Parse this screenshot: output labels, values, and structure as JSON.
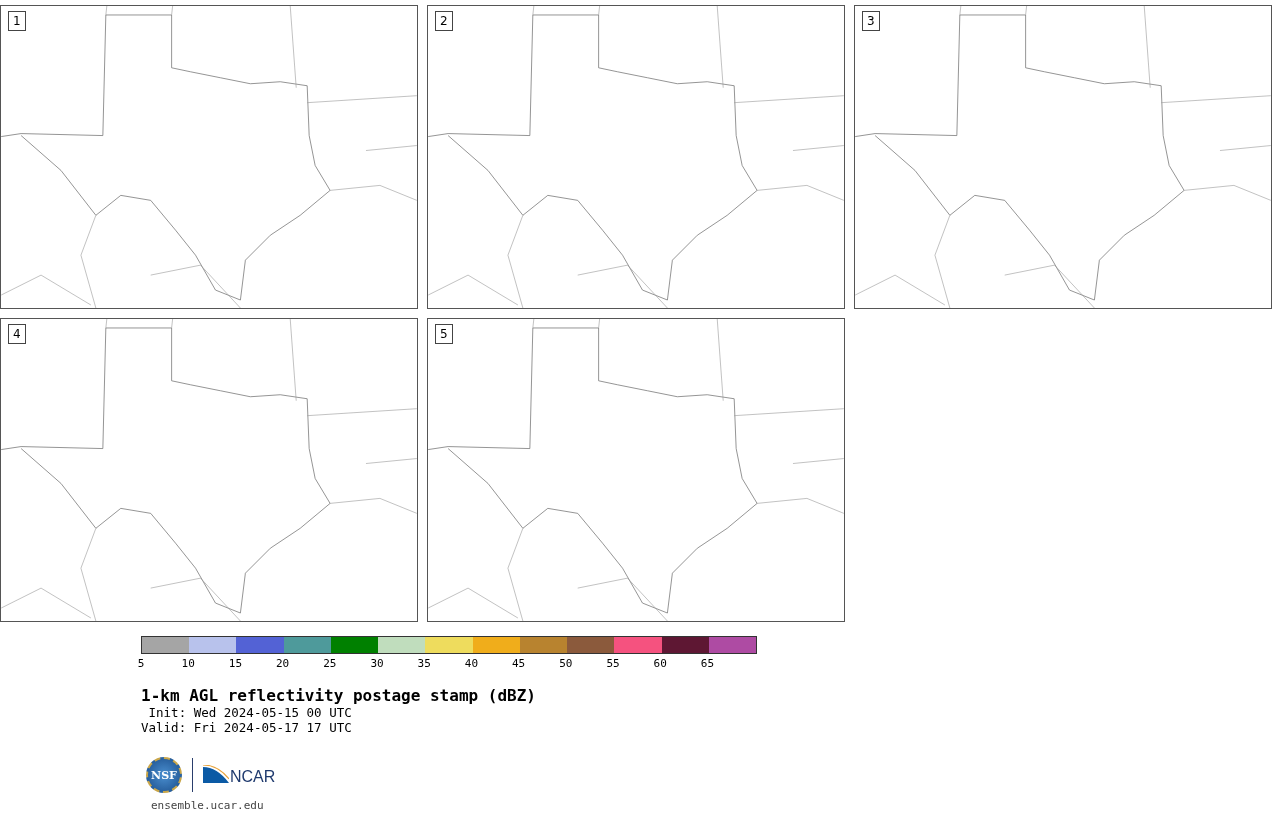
{
  "panels": [
    {
      "label": "1"
    },
    {
      "label": "2"
    },
    {
      "label": "3"
    },
    {
      "label": "4"
    },
    {
      "label": "5"
    }
  ],
  "colorbar": {
    "segments": [
      {
        "color": "#a5a5a5"
      },
      {
        "color": "#b8c2ec"
      },
      {
        "color": "#5362d5"
      },
      {
        "color": "#4e9a9b"
      },
      {
        "color": "#008000"
      },
      {
        "color": "#c0ddbd"
      },
      {
        "color": "#eedc5d"
      },
      {
        "color": "#f0ad1b"
      },
      {
        "color": "#b8832f"
      },
      {
        "color": "#8b5a3c"
      },
      {
        "color": "#f5527f"
      },
      {
        "color": "#5e1733"
      },
      {
        "color": "#ae4ba3"
      }
    ],
    "ticks": [
      "5",
      "10",
      "15",
      "20",
      "25",
      "30",
      "35",
      "40",
      "45",
      "50",
      "55",
      "60",
      "65"
    ]
  },
  "title": "1-km AGL reflectivity postage stamp (dBZ)",
  "init": " Init: Wed 2024-05-15 00 UTC",
  "valid": "Valid: Fri 2024-05-17 17 UTC",
  "logos": {
    "nsf": "NSF",
    "ncar": "NCAR"
  },
  "url": "ensemble.ucar.edu"
}
